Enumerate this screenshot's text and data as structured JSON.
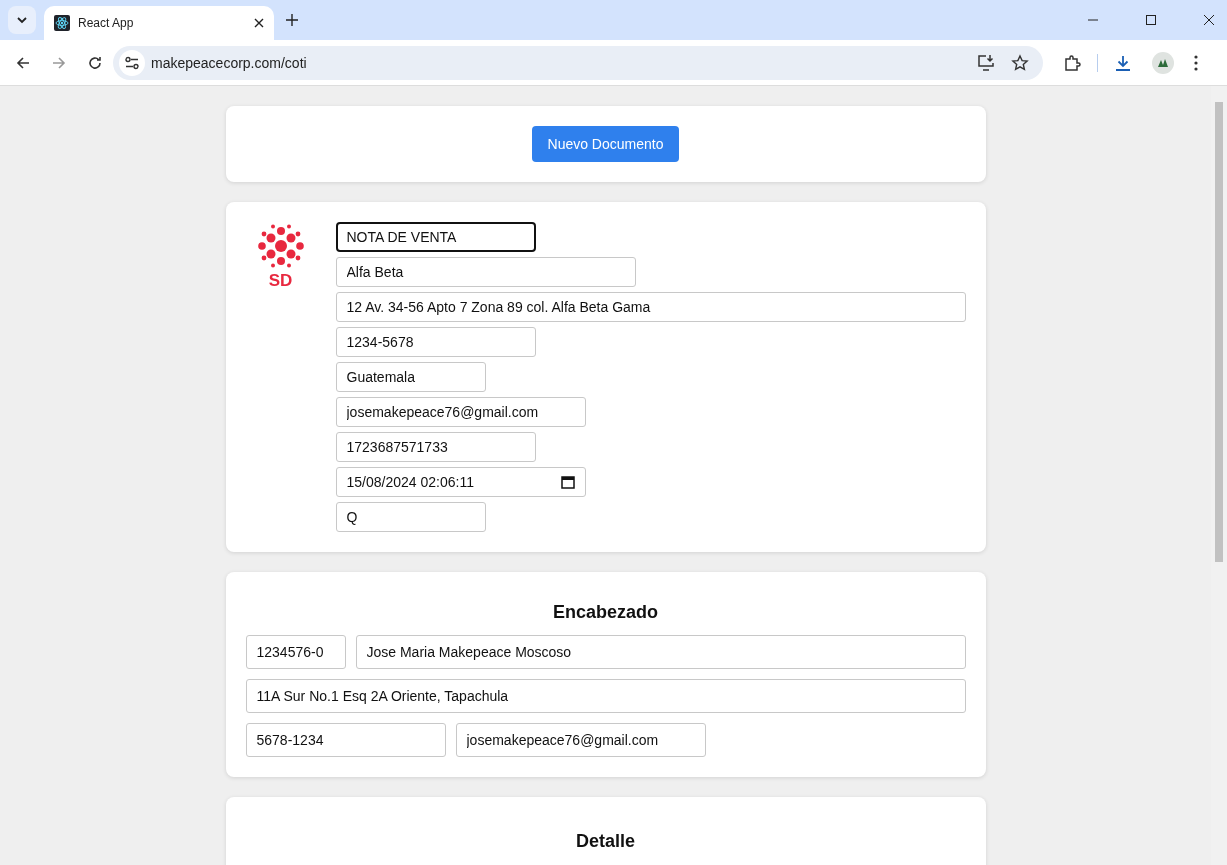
{
  "browser": {
    "tab_title": "React App",
    "url": "makepeacecorp.com/coti"
  },
  "toolbar": {
    "button": "Nuevo Documento"
  },
  "document": {
    "logo_text": "SD",
    "fields": [
      {
        "kind": "text",
        "value": "NOTA DE VENTA",
        "focused": true
      },
      {
        "kind": "text",
        "value": "Alfa Beta",
        "focused": false
      },
      {
        "kind": "text",
        "value": "12 Av. 34-56 Apto 7 Zona 89 col. Alfa Beta Gama",
        "focused": false
      },
      {
        "kind": "text",
        "value": "1234-5678",
        "focused": false
      },
      {
        "kind": "text",
        "value": "Guatemala",
        "focused": false
      },
      {
        "kind": "text",
        "value": "josemakepeace76@gmail.com",
        "focused": false
      },
      {
        "kind": "text",
        "value": "1723687571733",
        "focused": false
      },
      {
        "kind": "datetime",
        "value": "15/08/2024  02:06:11",
        "focused": false
      },
      {
        "kind": "text",
        "value": "Q",
        "focused": false
      }
    ]
  },
  "encabezado": {
    "title": "Encabezado",
    "rows": [
      [
        "1234576-0",
        "Jose Maria Makepeace Moscoso"
      ],
      [
        "11A Sur No.1 Esq 2A Oriente, Tapachula"
      ],
      [
        "5678-1234",
        "josemakepeace76@gmail.com"
      ]
    ]
  },
  "detalle": {
    "title": "Detalle"
  }
}
